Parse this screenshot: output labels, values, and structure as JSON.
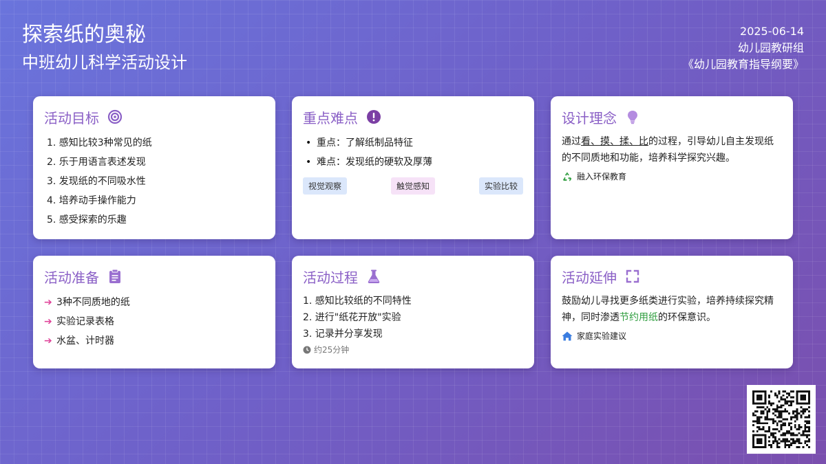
{
  "header": {
    "title": "探索纸的奥秘",
    "subtitle": "中班幼儿科学活动设计",
    "date": "2025-06-14",
    "team": "幼儿园教研组",
    "reference": "《幼儿园教育指导纲要》"
  },
  "goals": {
    "title": "活动目标",
    "items": [
      "1. 感知比较3种常见的纸",
      "2. 乐于用语言表述发现",
      "3. 发现纸的不同吸水性",
      "4. 培养动手操作能力",
      "5. 感受探索的乐趣"
    ]
  },
  "keypoints": {
    "title": "重点难点",
    "items": [
      "重点：了解纸制品特征",
      "难点：发现纸的硬软及厚薄"
    ],
    "tags": [
      "视觉观察",
      "触觉感知",
      "实验比较"
    ]
  },
  "concept": {
    "title": "设计理念",
    "text_pre": "通过",
    "text_underlined": "看、摸、揉、比",
    "text_post": "的过程，引导幼儿自主发现纸的不同质地和功能，培养科学探究兴趣。",
    "note": "融入环保教育"
  },
  "prep": {
    "title": "活动准备",
    "items": [
      "3种不同质地的纸",
      "实验记录表格",
      "水盆、计时器"
    ]
  },
  "process": {
    "title": "活动过程",
    "items": [
      "1. 感知比较纸的不同特性",
      "2. 进行\"纸花开放\"实验",
      "3. 记录并分享发现"
    ],
    "duration": "约25分钟"
  },
  "extension": {
    "title": "活动延伸",
    "text_pre": "鼓励幼儿寻找更多纸类进行实验，培养持续探究精神，同时渗透",
    "text_green": "节约用纸",
    "text_post": "的环保意识。",
    "note": "家庭实验建议"
  },
  "icons": {
    "goals": "target-icon",
    "keypoints": "exclamation-circle-icon",
    "concept": "lightbulb-icon",
    "prep": "clipboard-icon",
    "process": "flask-icon",
    "extension": "expand-icon",
    "recycle": "recycle-icon",
    "home": "home-icon",
    "clock": "clock-icon"
  },
  "colors": {
    "accent": "#8a5fc6",
    "arrow": "#e0449a",
    "green": "#2e9d3e",
    "home": "#3b7de0"
  }
}
